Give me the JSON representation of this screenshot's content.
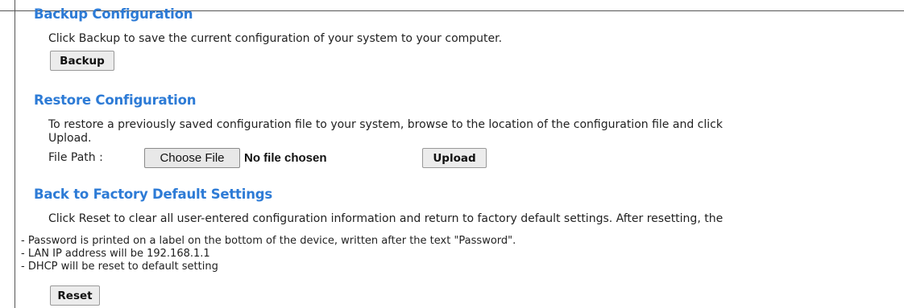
{
  "backup": {
    "heading": "Backup Configuration",
    "description": "Click Backup to save the current configuration of your system to your computer.",
    "button_label": "Backup"
  },
  "restore": {
    "heading": "Restore Configuration",
    "description_line1": "To restore a previously saved configuration file to your system, browse to the location of the configuration file and click",
    "description_line2": "Upload.",
    "file_path_label": "File Path :",
    "choose_file_label": "Choose File",
    "no_file_text": "No file chosen",
    "upload_label": "Upload"
  },
  "factory": {
    "heading": "Back to Factory Default Settings",
    "description": "Click Reset to clear all user-entered configuration information and return to factory default settings. After resetting, the",
    "notes": [
      "- Password is printed on a label on the bottom of the device, written after the text \"Password\".",
      "- LAN IP address will be 192.168.1.1",
      "- DHCP will be reset to default setting"
    ],
    "reset_label": "Reset"
  },
  "colors": {
    "heading": "#2d7bd6",
    "button_bg": "#ececec"
  }
}
